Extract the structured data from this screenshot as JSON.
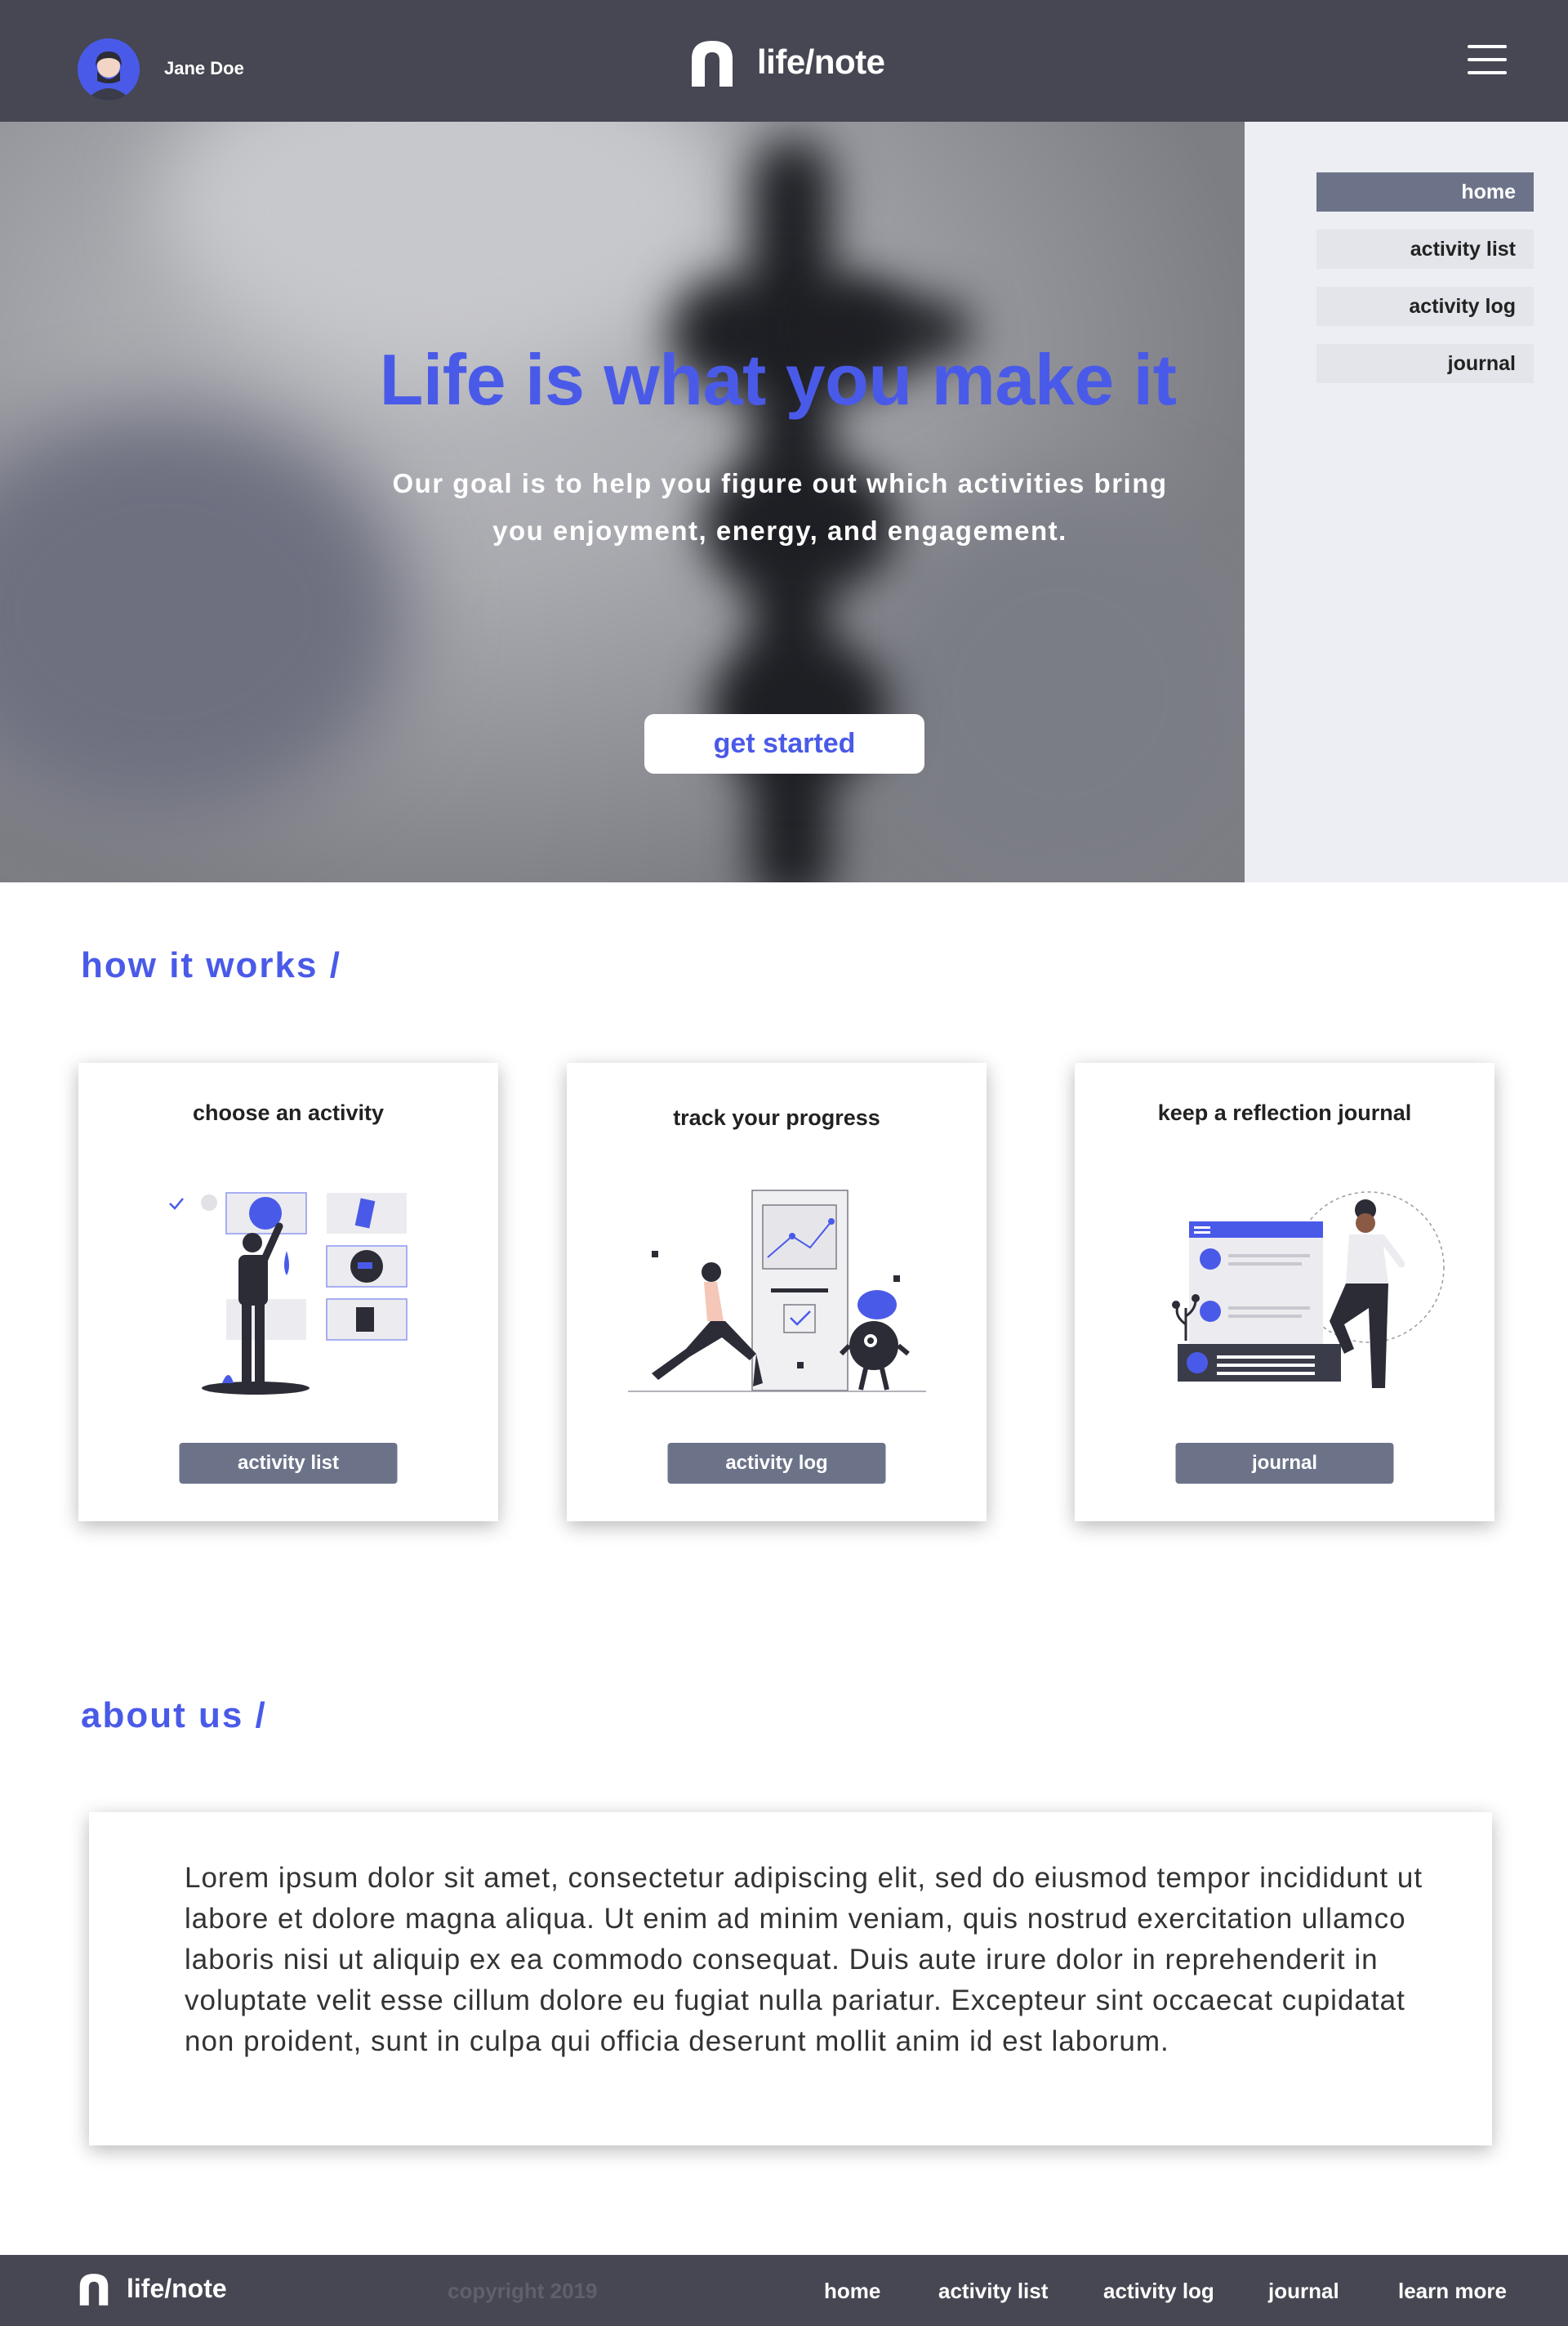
{
  "header": {
    "user_name": "Jane Doe",
    "logo_text": "life/note",
    "menu_icon": "hamburger-icon"
  },
  "hero": {
    "title": "Life is what you make it",
    "subtitle": "Our goal is to help you figure out which activities bring you enjoyment, energy, and engagement.",
    "cta_label": "get started"
  },
  "sidenav": {
    "items": [
      {
        "label": "home",
        "active": true
      },
      {
        "label": "activity list",
        "active": false
      },
      {
        "label": "activity log",
        "active": false
      },
      {
        "label": "journal",
        "active": false
      }
    ]
  },
  "how_it_works": {
    "title": "how it works /",
    "cards": [
      {
        "title": "choose an activity",
        "button": "activity list"
      },
      {
        "title": "track your progress",
        "button": "activity log"
      },
      {
        "title": "keep a reflection journal",
        "button": "journal"
      }
    ]
  },
  "about": {
    "title": "about us /",
    "text": "Lorem ipsum dolor sit amet, consectetur adipiscing elit, sed do eiusmod tempor incididunt ut labore et dolore magna aliqua. Ut enim ad minim veniam, quis nostrud exercitation ullamco laboris nisi ut aliquip ex ea commodo consequat. Duis aute irure dolor in reprehenderit in voluptate velit esse cillum dolore eu fugiat nulla pariatur. Excepteur sint occaecat cupidatat non proident, sunt in culpa qui officia deserunt mollit anim id est laborum."
  },
  "footer": {
    "logo_text": "life/note",
    "copyright": "copyright 2019",
    "links": [
      "home",
      "activity list",
      "activity log",
      "journal",
      "learn more"
    ]
  },
  "colors": {
    "accent": "#4a5ae8",
    "header_bg": "#464752",
    "button_gray": "#6c7389",
    "sidenav_bg": "#eceef3"
  }
}
